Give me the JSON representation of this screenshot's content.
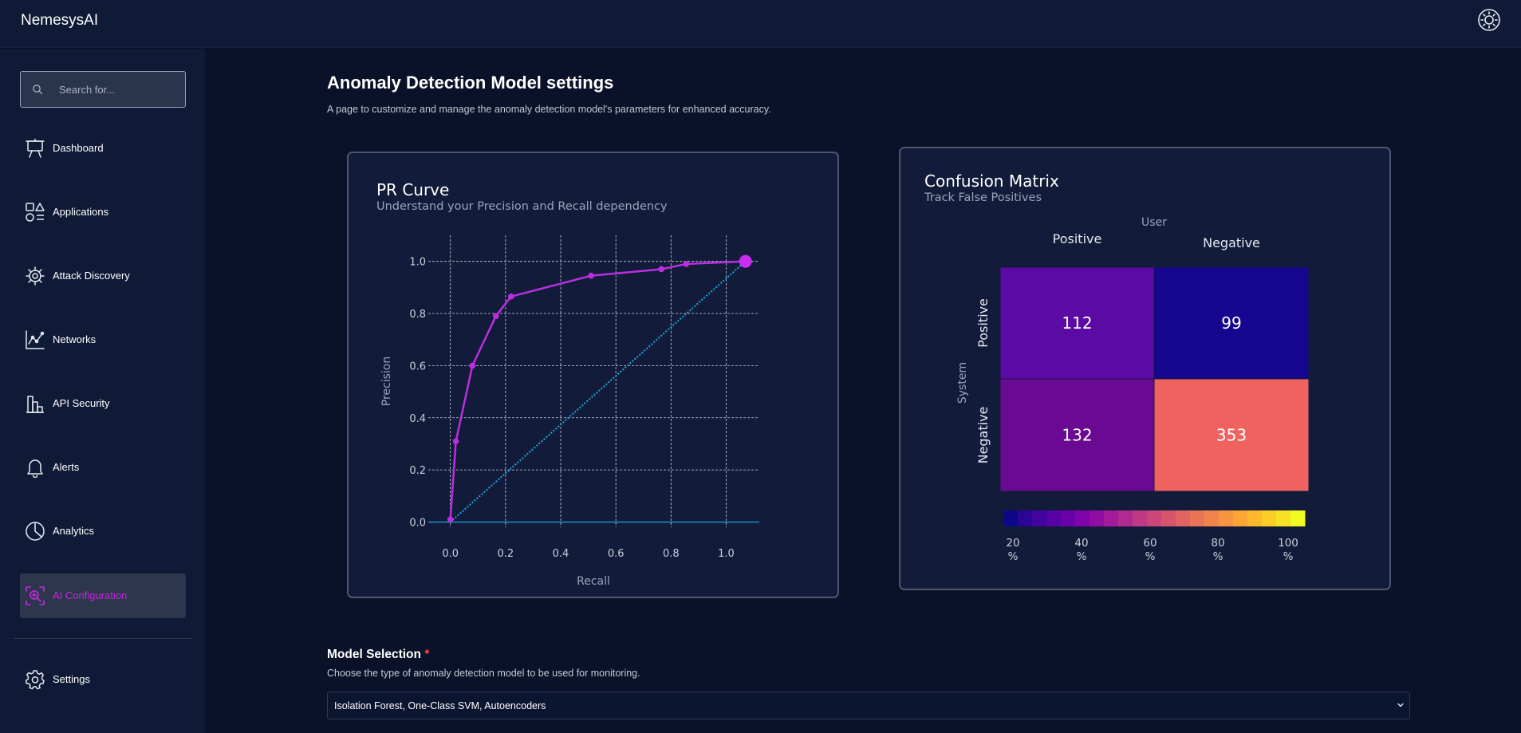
{
  "app": {
    "title": "NemesysAI",
    "theme_icon": "sun-icon"
  },
  "sidebar": {
    "search_placeholder": "Search for...",
    "items": [
      {
        "label": "Dashboard",
        "icon": "presentation-board-icon",
        "active": false
      },
      {
        "label": "Applications",
        "icon": "shapes-icon",
        "active": false
      },
      {
        "label": "Attack Discovery",
        "icon": "bug-gear-icon",
        "active": false
      },
      {
        "label": "Networks",
        "icon": "chart-line-icon",
        "active": false
      },
      {
        "label": "API Security",
        "icon": "bar-chart-icon",
        "active": false
      },
      {
        "label": "Alerts",
        "icon": "bell-icon",
        "active": false
      },
      {
        "label": "Analytics",
        "icon": "pie-chart-icon",
        "active": false
      },
      {
        "label": "AI Configuration",
        "icon": "focus-search-icon",
        "active": true
      }
    ],
    "settings": {
      "label": "Settings",
      "icon": "gear-icon"
    },
    "accent": "#c12bdb"
  },
  "page": {
    "title": "Anomaly Detection Model settings",
    "subtitle": "A page to customize and manage the anomaly detection model's parameters for enhanced accuracy."
  },
  "pr_card": {
    "title": "PR Curve",
    "subtitle": "Understand your Precision and Recall dependency"
  },
  "cm_card": {
    "title": "Confusion Matrix",
    "subtitle": "Track False Positives"
  },
  "chart_data": [
    {
      "type": "line",
      "xlabel": "Recall",
      "ylabel": "Precision",
      "xlim": [
        -0.08,
        1.12
      ],
      "ylim": [
        -0.02,
        1.1
      ],
      "xticks": [
        0.0,
        0.2,
        0.4,
        0.6,
        0.8,
        1.0
      ],
      "yticks": [
        0.0,
        0.2,
        0.4,
        0.6,
        0.8,
        1.0
      ],
      "tick_labels_x": [
        "0.0",
        "0.2",
        "0.4",
        "0.6",
        "0.8",
        "1.0"
      ],
      "tick_labels_y": [
        "0.0",
        "0.2",
        "0.4",
        "0.6",
        "0.8",
        "1.0"
      ],
      "grid": true,
      "series": [
        {
          "x": [
            0.0,
            0.02,
            0.08,
            0.165,
            0.22,
            0.51,
            0.765,
            0.855,
            1.07
          ],
          "y": [
            0.01,
            0.31,
            0.6,
            0.79,
            0.865,
            0.945,
            0.97,
            0.99,
            1.0
          ],
          "color": "#bb2ee0"
        }
      ],
      "baseline": {
        "x": [
          0.0,
          1.07
        ],
        "y": [
          0.0,
          1.0
        ],
        "color": "#1ea7d8"
      }
    },
    {
      "type": "heatmap",
      "xlabel": "User",
      "ylabel": "System",
      "columns": [
        "Positive",
        "Negative"
      ],
      "rows": [
        "Positive",
        "Negative"
      ],
      "values": [
        [
          112,
          99
        ],
        [
          132,
          353
        ]
      ],
      "colors": [
        [
          "#5b0aa3",
          "#16068f"
        ],
        [
          "#6a0a92",
          "#f0625f"
        ]
      ],
      "colorbar": {
        "tick_labels": [
          [
            "20",
            "%"
          ],
          [
            "40",
            "%"
          ],
          [
            "60",
            "%"
          ],
          [
            "80",
            "%"
          ],
          [
            "100",
            "%"
          ]
        ],
        "colors": [
          "#0d0887",
          "#2b0594",
          "#41049d",
          "#5602a4",
          "#6a00a8",
          "#7e03a8",
          "#8f0da4",
          "#a11b9b",
          "#b12a90",
          "#bf3984",
          "#cc4778",
          "#d6556d",
          "#e16462",
          "#ea7457",
          "#f2844b",
          "#f89540",
          "#fca636",
          "#feb82c",
          "#fccd25",
          "#f7e225",
          "#f0f921"
        ]
      }
    }
  ],
  "model_selection": {
    "title": "Model Selection",
    "required": "*",
    "description": "Choose the type of anomaly detection model to be used for monitoring.",
    "value": "Isolation Forest, One-Class SVM, Autoencoders"
  }
}
